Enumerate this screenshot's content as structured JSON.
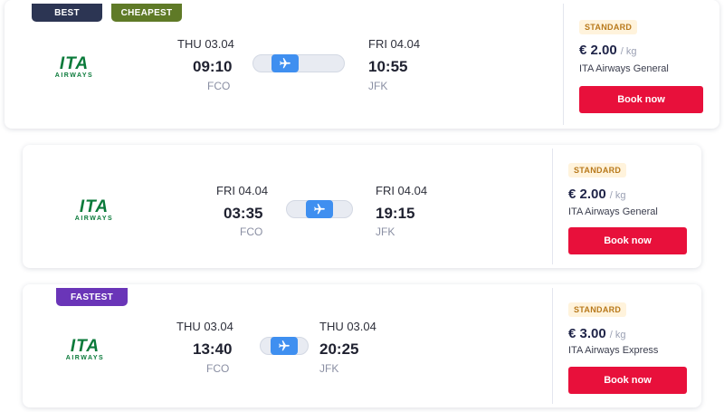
{
  "colors": {
    "best_badge": "#2c3553",
    "cheapest_badge": "#5f7a27",
    "fastest_badge": "#6a35b8",
    "book_button": "#e8103b",
    "plane_pill": "#3f8ff0",
    "airline_green": "#0a7a3a"
  },
  "results": [
    {
      "badges": [
        "BEST",
        "CHEAPEST"
      ],
      "airline_logo": {
        "top": "ITA",
        "bottom": "AIRWAYS"
      },
      "depart": {
        "date": "THU 03.04",
        "time": "09:10",
        "airport": "FCO"
      },
      "arrive": {
        "date": "FRI 04.04",
        "time": "10:55",
        "airport": "JFK"
      },
      "icon": "airplane-icon",
      "fare_tag": "STANDARD",
      "price": "€ 2.00",
      "price_unit": "/ kg",
      "fare_name": "ITA Airways General",
      "button": "Book now"
    },
    {
      "badges": [],
      "airline_logo": {
        "top": "ITA",
        "bottom": "AIRWAYS"
      },
      "depart": {
        "date": "FRI 04.04",
        "time": "03:35",
        "airport": "FCO"
      },
      "arrive": {
        "date": "FRI 04.04",
        "time": "19:15",
        "airport": "JFK"
      },
      "icon": "airplane-icon",
      "fare_tag": "STANDARD",
      "price": "€ 2.00",
      "price_unit": "/ kg",
      "fare_name": "ITA Airways General",
      "button": "Book now"
    },
    {
      "badges": [
        "FASTEST"
      ],
      "airline_logo": {
        "top": "ITA",
        "bottom": "AIRWAYS"
      },
      "depart": {
        "date": "THU 03.04",
        "time": "13:40",
        "airport": "FCO"
      },
      "arrive": {
        "date": "THU 03.04",
        "time": "20:25",
        "airport": "JFK"
      },
      "icon": "airplane-icon",
      "fare_tag": "STANDARD",
      "price": "€ 3.00",
      "price_unit": "/ kg",
      "fare_name": "ITA Airways Express",
      "button": "Book now"
    }
  ]
}
